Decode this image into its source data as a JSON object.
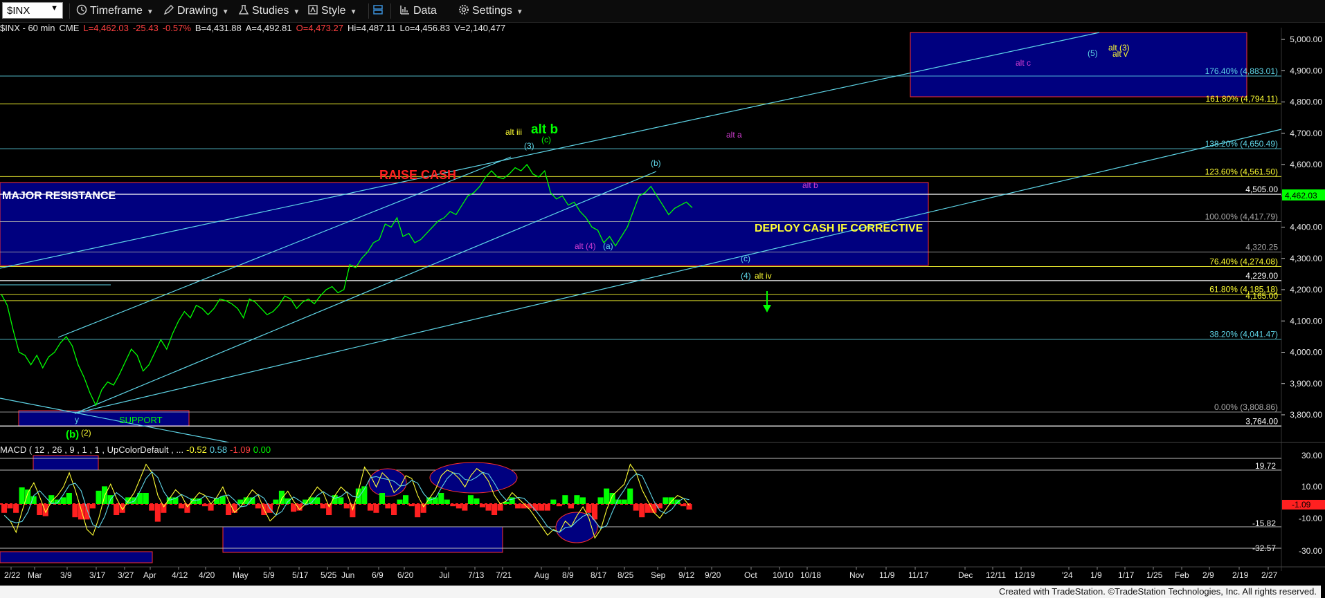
{
  "toolbar": {
    "symbol": "$INX",
    "timeframe": "Timeframe",
    "drawing": "Drawing",
    "studies": "Studies",
    "style": "Style",
    "data": "Data",
    "settings": "Settings"
  },
  "info": {
    "symbol_line": "$INX - 60 min",
    "exchange": "CME",
    "last": "L=4,462.03",
    "change": "-25.43",
    "change_pct": "-0.57%",
    "bid": "B=4,431.88",
    "ask": "A=4,492.81",
    "open": "O=4,473.27",
    "high": "Hi=4,487.11",
    "low": "Lo=4,456.83",
    "volume": "V=2,140,477"
  },
  "macd": {
    "label": "MACD ( 12 , 26 , 9 , 1 , 1 , UpColorDefault , ...",
    "v1": "-0.52",
    "v2": "0.58",
    "v3": "-1.09",
    "v4": "0.00"
  },
  "footer": "Created with TradeStation. ©TradeStation Technologies, Inc. All rights reserved.",
  "colors": {
    "zone": "#00007f",
    "price": "#00ff00",
    "cyan": "#5fd6e8",
    "yellow": "#ffff33",
    "magenta": "#d13dd1",
    "red": "#ff2020"
  },
  "chart_data": {
    "type": "line",
    "title": "$INX - 60 min",
    "ylim": [
      3750,
      5020
    ],
    "price_axis_ticks": [
      "5,000.00",
      "4,900.00",
      "4,800.00",
      "4,700.00",
      "4,600.00",
      "4,500.00",
      "4,400.00",
      "4,300.00",
      "4,200.00",
      "4,100.00",
      "4,000.00",
      "3,900.00",
      "3,800.00"
    ],
    "last_price_tag": "4,462.03",
    "date_ticks": [
      "2/22",
      "Mar",
      "3/9",
      "3/17",
      "3/27",
      "Apr",
      "4/12",
      "4/20",
      "May",
      "5/9",
      "5/17",
      "5/25",
      "Jun",
      "6/9",
      "6/20",
      "Jul",
      "7/13",
      "7/21",
      "Aug",
      "8/9",
      "8/17",
      "8/25",
      "Sep",
      "9/12",
      "9/20",
      "Oct",
      "10/10",
      "10/18",
      "Nov",
      "11/9",
      "11/17",
      "Dec",
      "12/11",
      "12/19",
      "'24",
      "1/9",
      "1/17",
      "1/25",
      "Feb",
      "2/9",
      "2/19",
      "2/27"
    ],
    "series": [
      {
        "values": [
          4185,
          4150,
          4070,
          4000,
          3990,
          3960,
          3990,
          3950,
          3985,
          4000,
          4030,
          4050,
          4020,
          3960,
          3920,
          3870,
          3830,
          3880,
          3905,
          3895,
          3930,
          3970,
          4010,
          3990,
          3940,
          3960,
          4000,
          4040,
          4010,
          4060,
          4100,
          4130,
          4110,
          4150,
          4140,
          4120,
          4140,
          4170,
          4165,
          4155,
          4140,
          4110,
          4170,
          4160,
          4140,
          4120,
          4130,
          4150,
          4180,
          4170,
          4140,
          4160,
          4170,
          4155,
          4180,
          4200,
          4210,
          4190,
          4200,
          4280,
          4270,
          4300,
          4320,
          4350,
          4360,
          4410,
          4400,
          4430,
          4370,
          4380,
          4350,
          4360,
          4380,
          4400,
          4420,
          4430,
          4450,
          4440,
          4470,
          4500,
          4510,
          4530,
          4560,
          4580,
          4560,
          4555,
          4570,
          4590,
          4580,
          4600,
          4570,
          4560,
          4580,
          4510,
          4490,
          4500,
          4470,
          4480,
          4450,
          4430,
          4400,
          4390,
          4350,
          4370,
          4340,
          4370,
          4400,
          4450,
          4500,
          4510,
          4530,
          4500,
          4470,
          4440,
          4460,
          4470,
          4480,
          4462
        ]
      }
    ],
    "levels": [
      {
        "label": "176.40% (4,883.01)",
        "value": 4883.01
      },
      {
        "label": "161.80% (4,794.11)",
        "value": 4794.11
      },
      {
        "label": "138.20% (4,650.49)",
        "value": 4650.49
      },
      {
        "label": "123.60% (4,561.50)",
        "value": 4561.5
      },
      {
        "label": "4,505.00",
        "value": 4505.0
      },
      {
        "label": "100.00% (4,417.79)",
        "value": 4417.79
      },
      {
        "label": "4,320.25",
        "value": 4320.25
      },
      {
        "label": "76.40% (4,274.08)",
        "value": 4274.08
      },
      {
        "label": "4,229.00",
        "value": 4229.0
      },
      {
        "label": "61.80% (4,185.18)",
        "value": 4185.18
      },
      {
        "label": "4,165.00",
        "value": 4165.0
      },
      {
        "label": "38.20% (4,041.47)",
        "value": 4041.47
      },
      {
        "label": "0.00% (3,808.86)",
        "value": 3808.86
      },
      {
        "label": "3,764.00",
        "value": 3764.0
      }
    ],
    "annotations": {
      "major_resistance": "MAJOR RESISTANCE",
      "raise_cash": "RAISE CASH",
      "deploy_cash": "DEPLOY CASH IF CORRECTIVE",
      "support": "SUPPORT",
      "alt_b_big": "alt b",
      "alt_iii": "alt iii",
      "c_small": "(c)",
      "three": "(3)",
      "alt_a": "alt a",
      "b_small": "(b)",
      "alt_b_mag": "alt b",
      "alt_4": "alt (4)",
      "a_small": "(a)",
      "c_cyan": "(c)",
      "four": "(4)",
      "alt_iv": "alt iv",
      "alt_c": "alt c",
      "five": "(5)",
      "alt_3": "alt (3)",
      "alt_v": "alt v",
      "y_lbl": "y",
      "b_green": "(b)",
      "two": "(2)"
    },
    "macd_axis_ticks": [
      "30.00",
      "19.72",
      "10.00",
      "-1.09",
      "-10.00",
      "-15.82",
      "-32.57",
      "-30.00"
    ],
    "macd_values": [
      -8,
      -12,
      -20,
      -5,
      8,
      15,
      5,
      -6,
      2,
      6,
      12,
      22,
      10,
      -4,
      -18,
      -22,
      -10,
      6,
      14,
      4,
      -4,
      2,
      8,
      18,
      28,
      22,
      6,
      -2,
      4,
      10,
      6,
      -2,
      3,
      8,
      6,
      0,
      5,
      12,
      2,
      -6,
      -2,
      4,
      10,
      6,
      -4,
      -12,
      -8,
      4,
      9,
      2,
      -4,
      0,
      6,
      12,
      8,
      -2,
      6,
      12,
      8,
      -4,
      10,
      26,
      20,
      12,
      22,
      18,
      8,
      12,
      20,
      18,
      6,
      -2,
      4,
      10,
      20,
      24,
      22,
      18,
      12,
      20,
      25,
      22,
      16,
      6,
      0,
      2,
      8,
      4,
      0,
      -4,
      -10,
      -16,
      -22,
      -18,
      -20,
      -12,
      -16,
      -8,
      -2,
      -10,
      -24,
      -18,
      -4,
      6,
      10,
      14,
      28,
      22,
      10,
      2,
      -6,
      -10,
      -4,
      2,
      6,
      4,
      -1.09
    ]
  }
}
